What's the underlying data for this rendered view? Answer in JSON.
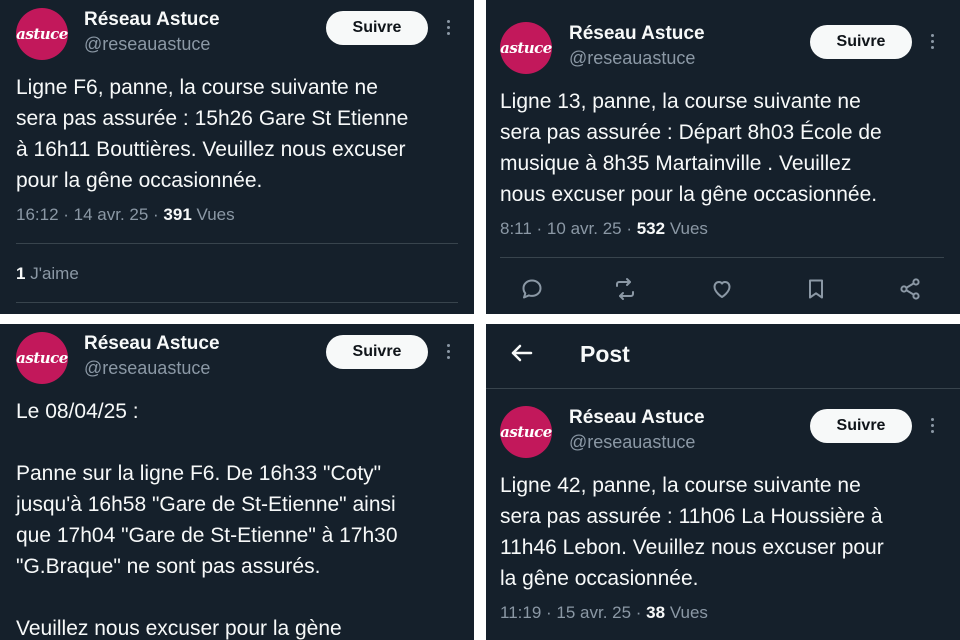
{
  "colors": {
    "background": "#15202b",
    "text": "#f7f9f9",
    "muted": "#8b98a5",
    "avatar": "#c2185b",
    "follow_bg": "#f7f9f9"
  },
  "tweets": [
    {
      "author": "Réseau Astuce",
      "handle": "@reseauastuce",
      "avatar_text": "astuce",
      "follow_label": "Suivre",
      "text": "Ligne F6, panne, la course suivante ne\nsera pas assurée : 15h26 Gare St Etienne\nà 16h11 Bouttières. Veuillez nous excuser\npour la gêne occasionnée.",
      "time": "16:12 · 14 avr. 25 · ",
      "views": "391",
      "views_label": " Vues",
      "likes_count": "1",
      "likes_label": " J'aime"
    },
    {
      "author": "Réseau Astuce",
      "handle": "@reseauastuce",
      "avatar_text": "astuce",
      "follow_label": "Suivre",
      "text": "Ligne 13, panne, la course suivante ne\nsera pas assurée : Départ 8h03 École de\nmusique à 8h35 Martainville . Veuillez\nnous excuser pour la gêne occasionnée.",
      "time": "8:11 · 10 avr. 25 · ",
      "views": "532",
      "views_label": " Vues",
      "actions": [
        "reply-icon",
        "retweet-icon",
        "like-icon",
        "bookmark-icon",
        "share-icon"
      ]
    },
    {
      "author": "Réseau Astuce",
      "handle": "@reseauastuce",
      "avatar_text": "astuce",
      "follow_label": "Suivre",
      "text": "Le 08/04/25 :\n\nPanne sur la ligne F6. De 16h33 \"Coty\"\njusqu'à 16h58 \"Gare de St-Etienne\" ainsi\nque 17h04 \"Gare de St-Etienne\" à 17h30\n\"G.Braque\" ne sont pas assurés.\n\nVeuillez nous excuser pour la gène"
    },
    {
      "header_title": "Post",
      "author": "Réseau Astuce",
      "handle": "@reseauastuce",
      "avatar_text": "astuce",
      "follow_label": "Suivre",
      "text": "Ligne 42, panne, la course suivante ne\nsera pas assurée : 11h06 La Houssière à\n11h46 Lebon. Veuillez nous excuser pour\nla gêne occasionnée.",
      "time": "11:19 · 15 avr. 25 · ",
      "views": "38",
      "views_label": " Vues"
    }
  ]
}
